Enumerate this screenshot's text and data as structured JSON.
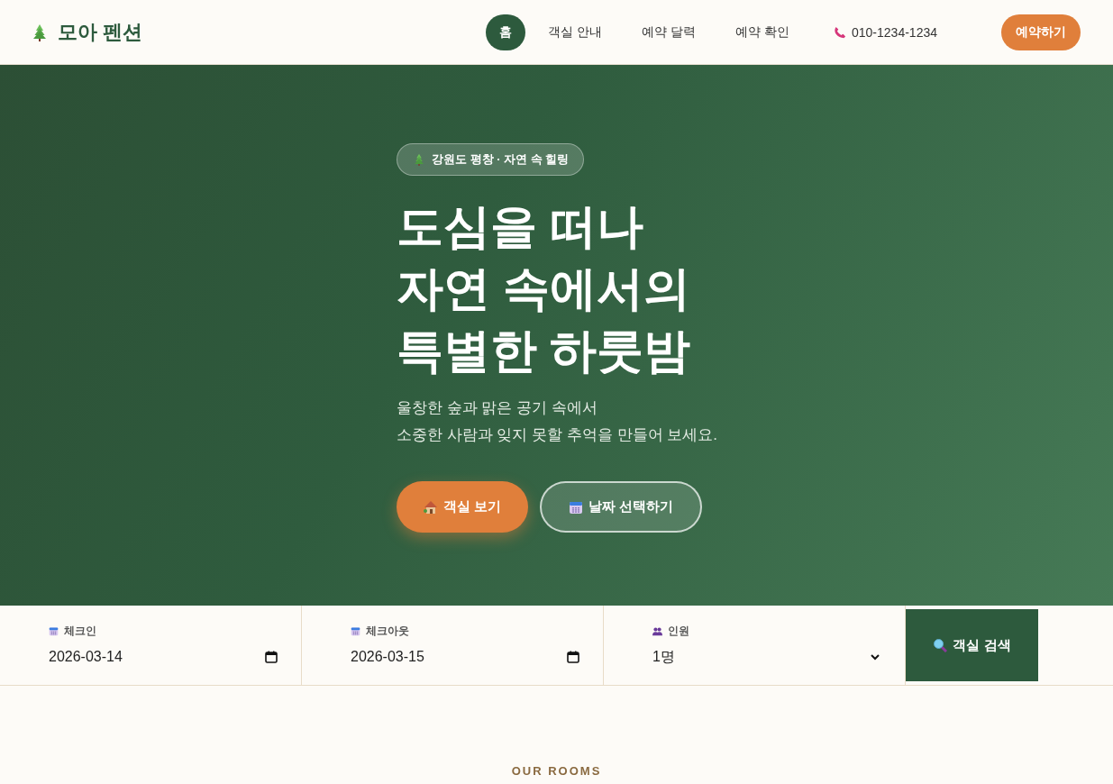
{
  "header": {
    "logo": "모아 펜션",
    "nav": [
      {
        "label": "홈",
        "selected": true
      },
      {
        "label": "객실 안내",
        "selected": false
      },
      {
        "label": "예약 달력",
        "selected": false
      },
      {
        "label": "예약 확인",
        "selected": false
      }
    ],
    "phone": "010-1234-1234",
    "cta": "예약하기"
  },
  "hero": {
    "badge": "강원도 평창 · 자연 속 힐링",
    "title_lines": [
      "도심을 떠나",
      "자연 속에서의",
      "특별한 하룻밤"
    ],
    "subtitle_lines": [
      "울창한 숲과 맑은 공기 속에서",
      "소중한 사람과 잊지 못할 추억을 만들어 보세요."
    ],
    "buttons": [
      {
        "label": "객실 보기",
        "kind": "primary"
      },
      {
        "label": "날짜 선택하기",
        "kind": "outline"
      }
    ]
  },
  "search": {
    "fields": [
      {
        "label": "체크인",
        "value": "2026-03-14",
        "kind": "date"
      },
      {
        "label": "체크아웃",
        "value": "2026-03-15",
        "kind": "date"
      },
      {
        "label": "인원",
        "value": "1명",
        "kind": "select"
      }
    ],
    "button": "객실 검색"
  },
  "section": {
    "eyebrow": "OUR ROOMS"
  }
}
